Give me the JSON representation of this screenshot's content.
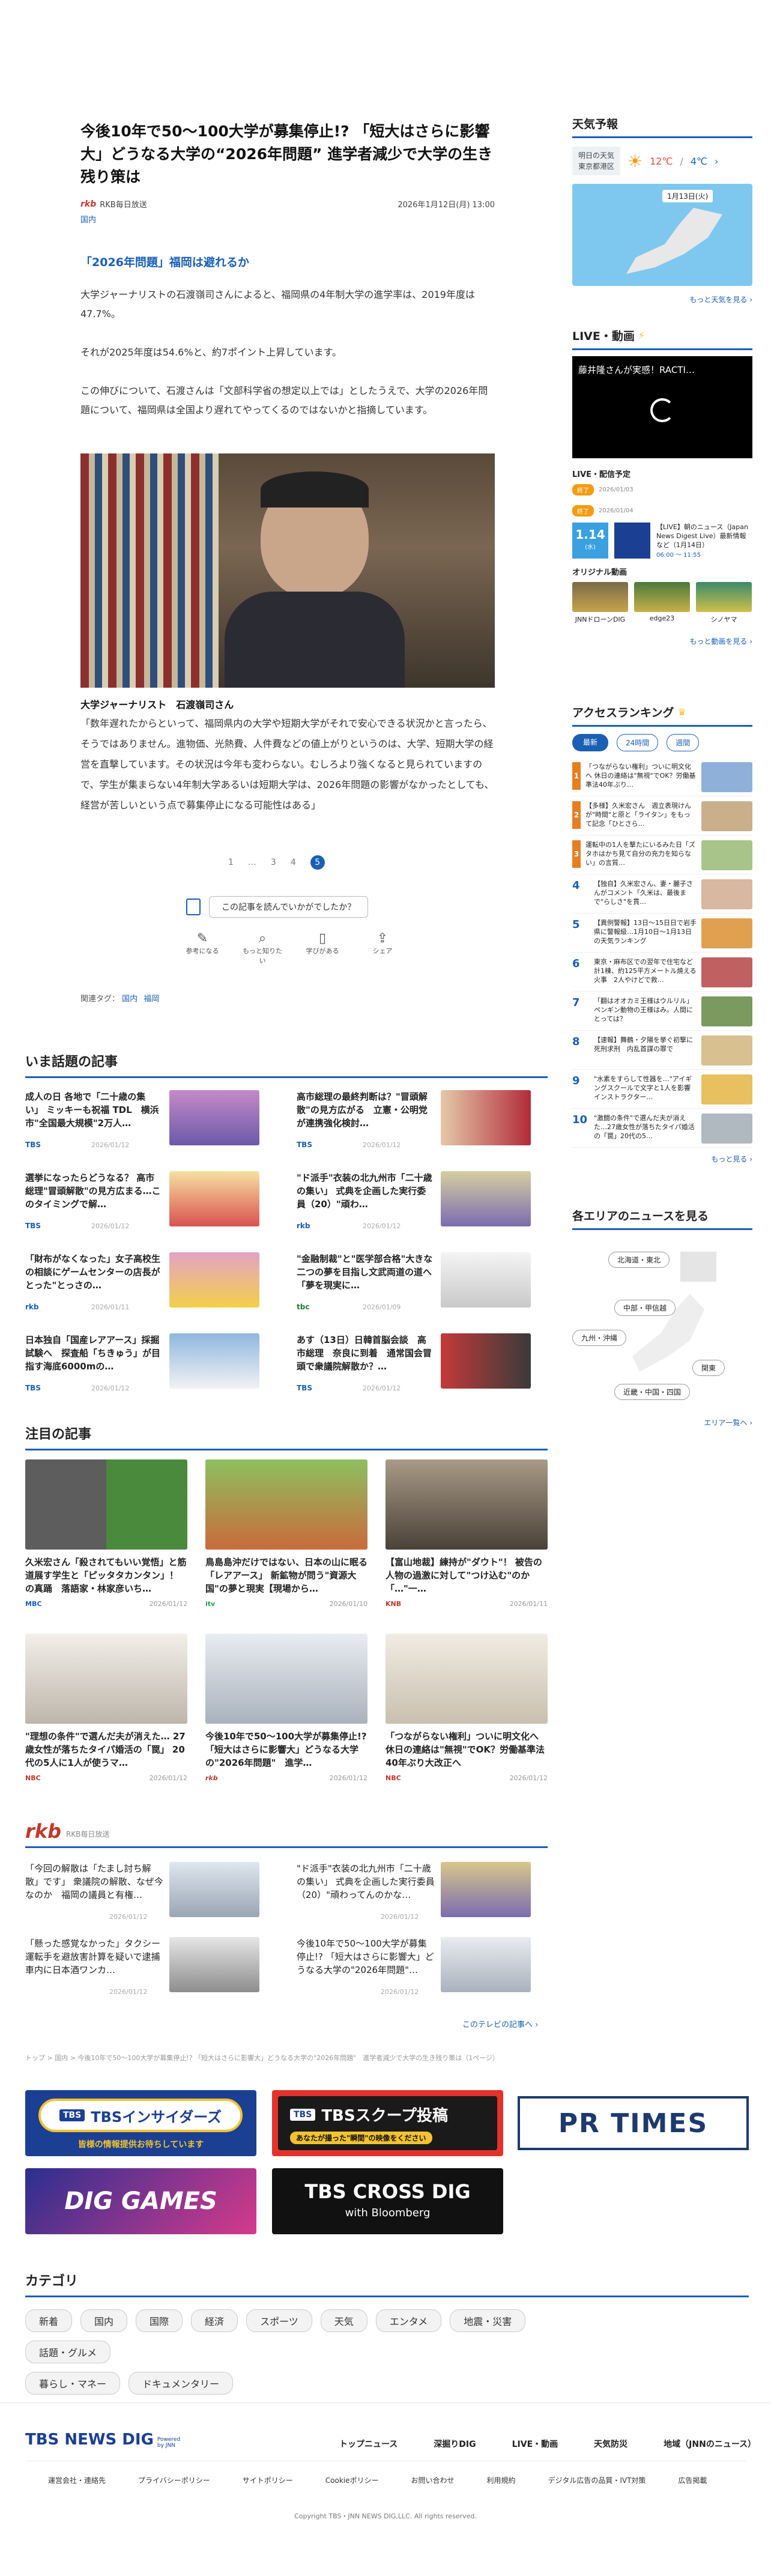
{
  "article": {
    "title": "今後10年で50～100大学が募集停止!? 「短大はさらに影響大」どうなる大学の“2026年問題” 進学者減少で大学の生き残り策は",
    "source": "RKB毎日放送",
    "category": "国内",
    "date": "2026年1月12日(月) 13:00",
    "subheading": "「2026年問題」福岡は避れるか",
    "paragraphs": [
      "大学ジャーナリストの石渡嶺司さんによると、福岡県の4年制大学の進学率は、2019年度は47.7%。",
      "それが2025年度は54.6%と、約7ポイント上昇しています。",
      "この伸びについて、石渡さんは「文部科学省の想定以上では」としたうえで、大学の2026年問題について、福岡県は全国より遅れてやってくるのではないかと指摘しています。"
    ],
    "caption": "大学ジャーナリスト　石渡嶺司さん",
    "quote": "「数年遅れたからといって、福岡県内の大学や短期大学がそれで安心できる状況かと言ったら、そうではありません。進物価、光熱費、人件費などの値上がりというのは、大学、短期大学の経営を直撃しています。その状況は今年も変わらない。むしろより強くなると見られていますので、学生が集まらない4年制大学あるいは短期大学は、2026年問題の影響がなかったとしても、経営が苦しいという点で募集停止になる可能性はある」",
    "pagination": [
      "1",
      "…",
      "3",
      "4",
      "5"
    ],
    "feedback": "この記事を読んでいかがでしたか？",
    "reactions": [
      "参考になる",
      "もっと知りたい",
      "学びがある",
      "シェア"
    ],
    "related_label": "関連タグ：",
    "related_tags": [
      "国内",
      "福岡"
    ]
  },
  "hot": {
    "title": "いま話題の記事",
    "items": [
      {
        "title": "成人の日 各地で「二十歳の集い」 ミッキーも祝福 TDL　横浜市\"全国最大規模\"2万人…",
        "src": "TBS",
        "date": "2026/01/12"
      },
      {
        "title": "高市総理の最終判断は？\"冒頭解散\"の見方広がる　立憲・公明党が連携強化検討…",
        "src": "TBS",
        "date": "2026/01/12"
      },
      {
        "title": "選挙になったらどうなる？ 高市総理\"冒頭解散\"の見方広まる…このタイミングで解…",
        "src": "TBS",
        "date": "2026/01/12"
      },
      {
        "title": "\"ド派手\"衣装の北九州市「二十歳の集い」 式典を企画した実行委員（20）\"頑わ…",
        "src": "rkb",
        "date": "2026/01/12"
      },
      {
        "title": "「財布がなくなった」女子高校生の相談にゲームセンターの店長がとった\"とっさの…",
        "src": "rkb",
        "date": "2026/01/11"
      },
      {
        "title": "\"金融制裁\"と\"医学部合格\"大きな二つの夢を目指し文武両道の道へ「夢を現実に…",
        "src": "tbc",
        "date": "2026/01/09"
      },
      {
        "title": "日本独自「国産レアアース」採掘試験へ　探査船「ちきゅう」が目指す海底6000mの…",
        "src": "TBS",
        "date": "2026/01/12"
      },
      {
        "title": "あす（13日）日韓首脳会談　高市総理　奈良に到着　通常国会冒頭で衆議院解散か？…",
        "src": "TBS",
        "date": "2026/01/12"
      }
    ]
  },
  "attention": {
    "title": "注目の記事",
    "items": [
      {
        "title": "久米宏さん「殺されてもいい覚悟」と筋道展す学生と「ピッタタカンタン」！ の真踊　落語家・林家彦いち…",
        "src": "MBC",
        "date": "2026/01/12"
      },
      {
        "title": "鳥島島沖だけではない、日本の山に眠る「レアアース」 新鉱物が問う\"資源大国\"の夢と現実【現場から…",
        "src": "itv",
        "date": "2026/01/10"
      },
      {
        "title": "【富山地裁】練持が\"ダウト\"！ 被告の人物の過激に対して\"つけ込む\"のか「…\"一…",
        "src": "KNB",
        "date": "2026/01/11"
      },
      {
        "title": "\"理想の条件\"で選んだ夫が消えた… 27歳女性が落ちたタイパ婚活の「罠」 20代の5人に1人が使うマ…",
        "src": "NBC",
        "date": "2026/01/12"
      },
      {
        "title": "今後10年で50～100大学が募集停止!? 「短大はさらに影響大」どうなる大学の\"2026年問題\"　進学…",
        "src": "rkb",
        "date": "2026/01/12"
      },
      {
        "title": "「つながらない権利」ついに明文化へ 休日の連絡は\"無視\"でOK？労働基準法40年ぶり大改正へ",
        "src": "NBC",
        "date": "2026/01/12"
      }
    ]
  },
  "rkb": {
    "logo": "rkb",
    "label": "RKB毎日放送",
    "items": [
      {
        "title": "「今回の解散は「たまし討ち解散」です」 衆議院の解散、なぜ今なのか　福岡の議員と有権…",
        "date": "2026/01/12"
      },
      {
        "title": "\"ド派手\"衣装の北九州市「二十歳の集い」 式典を企画した実行委員（20）\"頑わってんのかな…",
        "date": "2026/01/12"
      },
      {
        "title": "「懸った感覚なかった」タクシー運転手を避放害計算を疑いで逮捕　車内に日本酒ワンカ…",
        "date": "2026/01/12"
      },
      {
        "title": "今後10年で50～100大学が募集停止!? 「短大はさらに影響大」どうなる大学の\"2026年問題\"…",
        "date": "2026/01/12"
      }
    ],
    "more": "このテレビの記事へ ›"
  },
  "breadcrumb": "トップ > 国内 > 今後10年で50～100大学が募集停止!? 「短大はさらに影響大」どうなる大学の\"2026年問題\"　進学者減少で大学の生き残り策は（1ページ）",
  "banners": {
    "insider": {
      "main": "TBSインサイダーズ",
      "sub": "皆様の情報提供お待ちしています"
    },
    "scoop": {
      "main": "TBSスクープ投稿",
      "sub": "あなたが撮った\"瞬間\"の映像をください"
    },
    "prtimes": "PR TIMES",
    "games": "DIG GAMES",
    "crossdig": {
      "main": "TBS CROSS DIG",
      "sub": "with Bloomberg"
    }
  },
  "categories": {
    "title": "カテゴリ",
    "items": [
      "新着",
      "国内",
      "国際",
      "経済",
      "スポーツ",
      "天気",
      "エンタメ",
      "地震・災害",
      "話題・グルメ",
      "暮らし・マネー",
      "ドキュメンタリー"
    ]
  },
  "footer": {
    "logo": "TBS NEWS DIG",
    "logo_sub": "Powered by JNN",
    "nav": [
      "トップニュース",
      "深掘りDIG",
      "LIVE・動画",
      "天気防災",
      "地域（JNNのニュース）"
    ],
    "links": [
      "運営会社・連絡先",
      "プライバシーポリシー",
      "サイトポリシー",
      "Cookieポリシー",
      "お問い合わせ",
      "利用規約",
      "デジタル広告の品質・IVT対策",
      "広告掲載"
    ],
    "copyright": "Copyright TBS・JNN NEWS DIG,LLC. All rights reserved."
  },
  "sidebar": {
    "weather": {
      "title": "天気予報",
      "tab_label": "明日の天気",
      "location": "東京都港区",
      "temp_high": "12℃",
      "temp_low": "4℃",
      "date": "1月13日(火)",
      "more": "もっと天気を見る ›"
    },
    "live": {
      "title": "LIVE・動画",
      "video_title": "藤井隆さんが実感！RACTI…",
      "schedule_title": "LIVE・配信予定",
      "schedule": [
        {
          "badge": "終了",
          "date": "2026/01/03"
        },
        {
          "badge": "終了",
          "date": "2026/01/04"
        }
      ],
      "featured": {
        "time": "1.14",
        "day": "(水)",
        "title": "【LIVE】朝のニュース（Japan News Digest Live）最新情報など（1月14日）",
        "sub": "06:00 ～ 11:55"
      },
      "original_title": "オリジナル動画",
      "originals": [
        "JNNドローンDIG",
        "edge23",
        "シノヤマ"
      ],
      "more": "もっと動画を見る ›"
    },
    "ranking": {
      "title": "アクセスランキング",
      "tabs": [
        "最新",
        "24時間",
        "週間"
      ],
      "items": [
        "「つながらない権利」ついに明文化へ 休日の連絡は\"無視\"でOK？労働基準法40年ぶり…",
        "【多様】久米宏さん　週立表現けんが\"時間\"と原と「ライタン」をもって記念「ひとさら…",
        "運転中の1人を撃たにいるみた日「ズタホはかち見て自分の充力を知らない」の言質…",
        "【独自】久米宏さん、妻・麗子さんがコメント「久米は、最後まで\"らしさ\"を貫…",
        "【異例警報】13日～15日日で岩手県に警報級…1月10日～1月13日の天気ランキング",
        "東京・麻布区での翌年で住宅など計1棟、約125平方メートル焼える火事　2人やけどで救…",
        "「翻はオオカミ王様はウルリル」ペンギン動物の王様はみ。人間にとっては？",
        "【速報】舞鶴・夕陽を挙ぐ初撃に死刑求刑　内乱首謀の罪で",
        "\"水素をすらして性器を…\"アイギングスクールで文字と1人を影響　インストラクター…",
        "\"激闘の条件\"で選んだ夫が消えた…27歳女性が落ちたタイパ婚活の「罠」20代の5…"
      ],
      "more": "もっと見る ›"
    },
    "area": {
      "title": "各エリアのニュースを見る",
      "regions": [
        "北海道・東北",
        "中部・甲信越",
        "九州・沖縄",
        "関東",
        "近畿・中国・四国"
      ],
      "more": "エリア一覧へ ›"
    }
  }
}
